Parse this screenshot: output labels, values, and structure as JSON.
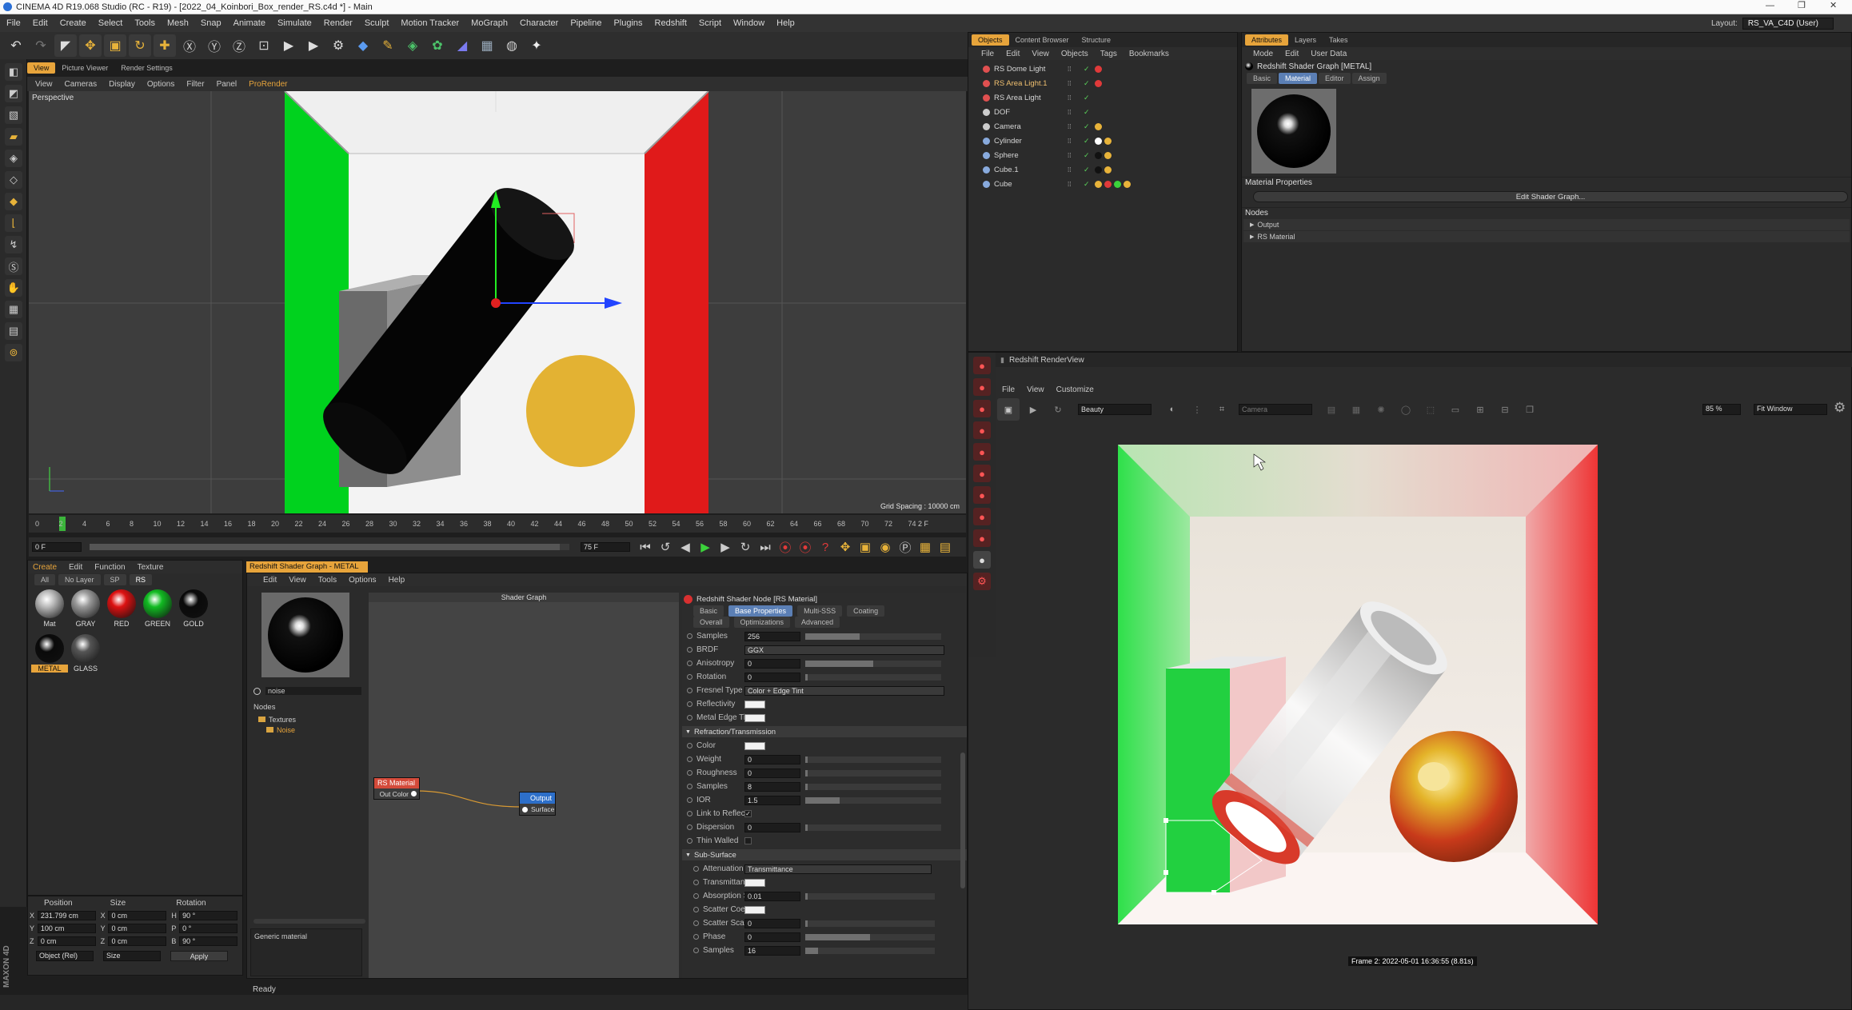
{
  "title": "CINEMA 4D R19.068 Studio (RC - R19) - [2022_04_Koinbori_Box_render_RS.c4d *] - Main",
  "menu": [
    "File",
    "Edit",
    "Create",
    "Select",
    "Tools",
    "Mesh",
    "Snap",
    "Animate",
    "Simulate",
    "Render",
    "Sculpt",
    "Motion Tracker",
    "MoGraph",
    "Character",
    "Pipeline",
    "Plugins",
    "Redshift",
    "Script",
    "Window",
    "Help"
  ],
  "layout_label": "Layout:",
  "layout_value": "RS_VA_C4D (User)",
  "view_tabs": [
    "View",
    "Picture Viewer",
    "Render Settings"
  ],
  "viewport_menu": [
    "View",
    "Cameras",
    "Display",
    "Options",
    "Filter",
    "Panel",
    "ProRender"
  ],
  "viewport_label": "Perspective",
  "grid_spacing": "Grid Spacing : 10000 cm",
  "timeline_ticks": [
    "0",
    "2",
    "4",
    "6",
    "8",
    "10",
    "12",
    "14",
    "16",
    "18",
    "20",
    "22",
    "24",
    "26",
    "28",
    "30",
    "32",
    "34",
    "36",
    "38",
    "40",
    "42",
    "44",
    "46",
    "48",
    "50",
    "52",
    "54",
    "56",
    "58",
    "60",
    "62",
    "64",
    "66",
    "68",
    "70",
    "72",
    "74"
  ],
  "timeline_end": "2 F",
  "frame_start": "0 F",
  "frame_end": "75 F",
  "objects_tabs": [
    "Objects",
    "Content Browser",
    "Structure"
  ],
  "objects_menu": [
    "File",
    "Edit",
    "View",
    "Objects",
    "Tags",
    "Bookmarks"
  ],
  "objects": [
    {
      "name": "RS Dome Light",
      "color": "#e05050"
    },
    {
      "name": "RS Area Light.1",
      "color": "#e05050"
    },
    {
      "name": "RS Area Light",
      "color": "#e05050"
    },
    {
      "name": "DOF",
      "color": "#cccccc"
    },
    {
      "name": "Camera",
      "color": "#cccccc"
    },
    {
      "name": "Cylinder",
      "color": "#88aadd"
    },
    {
      "name": "Sphere",
      "color": "#88aadd"
    },
    {
      "name": "Cube.1",
      "color": "#88aadd"
    },
    {
      "name": "Cube",
      "color": "#88aadd"
    }
  ],
  "attr_tabs": [
    "Attributes",
    "Layers",
    "Takes"
  ],
  "attr_menu": [
    "Mode",
    "Edit",
    "User Data"
  ],
  "attr_title": "Redshift Shader Graph [METAL]",
  "attr_subtabs": [
    "Basic",
    "Material",
    "Editor",
    "Assign"
  ],
  "material_properties": "Material Properties",
  "edit_shader_graph": "Edit Shader Graph...",
  "nodes_label": "Nodes",
  "nodes": [
    "Output",
    "RS Material"
  ],
  "rv_title": "Redshift RenderView",
  "rv_menu": [
    "File",
    "View",
    "Customize"
  ],
  "rv_beauty": "Beauty",
  "rv_camera": "Camera",
  "rv_zoom": "85 %",
  "rv_fit": "Fit Window",
  "rv_frame_info": "Frame 2: 2022-05-01 16:36:55 (8.81s)",
  "mat_menu": [
    "Create",
    "Edit",
    "Function",
    "Texture"
  ],
  "mat_filters": [
    "All",
    "No Layer",
    "SP",
    "RS"
  ],
  "materials": [
    {
      "name": "Mat",
      "color": "#bbbbbb"
    },
    {
      "name": "GRAY",
      "color": "#999999"
    },
    {
      "name": "RED",
      "color": "#dd1111"
    },
    {
      "name": "GREEN",
      "color": "#11bb22"
    },
    {
      "name": "GOLD",
      "color": "#0a0a0a"
    },
    {
      "name": "METAL",
      "color": "#0a0a0a"
    },
    {
      "name": "GLASS",
      "color": "#555555"
    }
  ],
  "coord_headers": [
    "Position",
    "Size",
    "Rotation"
  ],
  "coords": [
    {
      "a": "X",
      "av": "231.799 cm",
      "b": "X",
      "bv": "0 cm",
      "c": "H",
      "cv": "90 °"
    },
    {
      "a": "Y",
      "av": "100 cm",
      "b": "Y",
      "bv": "0 cm",
      "c": "P",
      "cv": "0 °"
    },
    {
      "a": "Z",
      "av": "0 cm",
      "b": "Z",
      "bv": "0 cm",
      "c": "B",
      "cv": "90 °"
    }
  ],
  "coord_mode1": "Object (Rel)",
  "coord_mode2": "Size",
  "coord_apply": "Apply",
  "sg_tab": "Redshift Shader Graph - METAL",
  "sg_menu": [
    "Edit",
    "View",
    "Tools",
    "Options",
    "Help"
  ],
  "sg_search": "noise",
  "sg_nodes_label": "Nodes",
  "sg_tree": [
    "Textures",
    "Noise"
  ],
  "sg_desc": "Generic material",
  "sg_graph_title": "Shader Graph",
  "node_rs_material": "RS Material",
  "node_out_color": "Out Color",
  "node_output": "Output",
  "node_surface": "Surface",
  "status": "Ready",
  "node_panel_title": "Redshift Shader Node [RS Material]",
  "node_tabs1": [
    "Basic",
    "Base Properties",
    "Multi-SSS",
    "Coating"
  ],
  "node_tabs2": [
    "Overall",
    "Optimizations",
    "Advanced"
  ],
  "props": [
    {
      "label": "Samples",
      "value": "256",
      "slider": 0.4
    },
    {
      "label": "BRDF",
      "value": "GGX",
      "dropdown": true
    },
    {
      "label": "Anisotropy",
      "value": "0",
      "slider": 0.5
    },
    {
      "label": "Rotation",
      "value": "0",
      "slider": 0.02
    },
    {
      "label": "Fresnel Type",
      "value": "Color + Edge Tint",
      "dropdown": true
    },
    {
      "label": "Reflectivity",
      "swatch": true
    },
    {
      "label": "Metal Edge Tint",
      "swatch": true
    }
  ],
  "refr_header": "Refraction/Transmission",
  "refr_props": [
    {
      "label": "Color",
      "swatch": true
    },
    {
      "label": "Weight",
      "value": "0",
      "slider": 0.02
    },
    {
      "label": "Roughness",
      "value": "0",
      "slider": 0.02
    },
    {
      "label": "Samples",
      "value": "8",
      "slider": 0.02
    },
    {
      "label": "IOR",
      "value": "1.5",
      "slider": 0.25
    },
    {
      "label": "Link to Reflection",
      "check": true
    },
    {
      "label": "Dispersion",
      "value": "0",
      "slider": 0.02
    },
    {
      "label": "Thin Walled",
      "check": false
    }
  ],
  "sss_header": "Sub-Surface",
  "sss_props": [
    {
      "label": "Attenuation Units",
      "value": "Transmittance",
      "dropdown": true
    },
    {
      "label": "Transmittance Color",
      "swatch": true
    },
    {
      "label": "Absorption Scale",
      "value": "0.01",
      "slider": 0.02
    },
    {
      "label": "Scatter Coeff",
      "swatch": true
    },
    {
      "label": "Scatter Scale",
      "value": "0",
      "slider": 0.02
    },
    {
      "label": "Phase",
      "value": "0",
      "slider": 0.5
    },
    {
      "label": "Samples",
      "value": "16",
      "slider": 0.1
    }
  ]
}
